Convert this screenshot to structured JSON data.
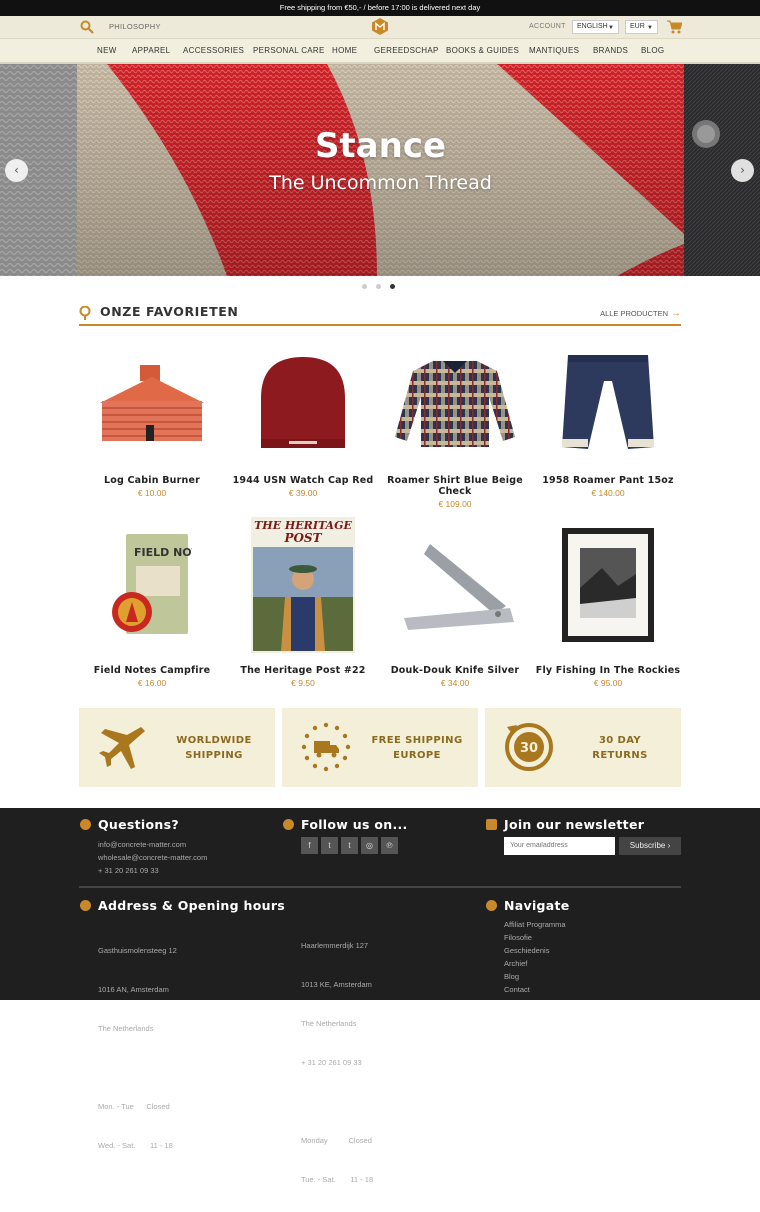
{
  "topbar": {
    "text": "Free shipping from €50,- / before 17:00 is delivered next day"
  },
  "header": {
    "philosophy": "PHILOSOPHY",
    "account": "ACCOUNT",
    "language": "ENGLISH",
    "currency": "EUR"
  },
  "nav": [
    "NEW",
    "APPAREL",
    "ACCESSORIES",
    "PERSONAL CARE",
    "HOME",
    "GEREEDSCHAP",
    "BOOKS & GUIDES",
    "MANTIQUES",
    "BRANDS",
    "BLOG"
  ],
  "hero": {
    "title": "Stance",
    "subtitle": "The Uncommon Thread",
    "slide_count": 3,
    "active_slide": 3
  },
  "favorites": {
    "title": "ONZE FAVORIETEN",
    "all_link": "ALLE PRODUCTEN"
  },
  "products": [
    {
      "name": "Log Cabin Burner",
      "price": "€ 10.00"
    },
    {
      "name": "1944 USN Watch Cap Red",
      "price": "€ 39.00"
    },
    {
      "name": "Roamer Shirt Blue Beige Check",
      "price": "€ 109.00"
    },
    {
      "name": "1958 Roamer Pant 15oz",
      "price": "€ 140.00"
    },
    {
      "name": "Field Notes Campfire",
      "price": "€ 16.00"
    },
    {
      "name": "The Heritage Post #22",
      "price": "€ 9.50"
    },
    {
      "name": "Douk-Douk Knife Silver",
      "price": "€ 34.00"
    },
    {
      "name": "Fly Fishing In The Rockies",
      "price": "€ 95.00"
    }
  ],
  "product_image_text": {
    "field_notes": "FIELD NOTES",
    "heritage_line1": "THE HERITAGE",
    "heritage_line2": "POST"
  },
  "features": [
    {
      "line1": "WORLDWIDE",
      "line2": "SHIPPING"
    },
    {
      "line1": "FREE SHIPPING",
      "line2": "EUROPE"
    },
    {
      "line1": "30 DAY",
      "line2": "RETURNS",
      "badge": "30"
    }
  ],
  "footer": {
    "questions": {
      "title": "Questions?",
      "lines": [
        "info@concrete-matter.com",
        "wholesale@concrete-matter.com",
        "+ 31 20 261 09 33"
      ]
    },
    "follow": {
      "title": "Follow us on...",
      "icons": [
        "f",
        "t",
        "t",
        "◎",
        "℗"
      ]
    },
    "newsletter": {
      "title": "Join our newsletter",
      "placeholder": "Your emailaddress",
      "button": "Subscribe ›"
    },
    "address": {
      "title": "Address & Opening hours",
      "col1": [
        "Gasthuismolensteeg 12",
        "1016 AN, Amsterdam",
        "The Netherlands",
        "",
        "Mon. - Tue      Closed",
        "Wed. - Sat.       11 - 18"
      ],
      "col2": [
        "Haarlemmerdijk 127",
        "1013 KE, Amsterdam",
        "The Netherlands",
        "+ 31 20 261 09 33",
        "",
        "Monday          Closed",
        "Tue. - Sat.       11 - 18"
      ]
    },
    "navigate": {
      "title": "Navigate",
      "links": [
        "Affiliat Programma",
        "Filosofie",
        "Geschiedenis",
        "Archief",
        "Blog",
        "Contact"
      ]
    }
  },
  "colors": {
    "accent": "#c8892a",
    "beige": "#f3efd9",
    "dark": "#1f1f1f"
  }
}
